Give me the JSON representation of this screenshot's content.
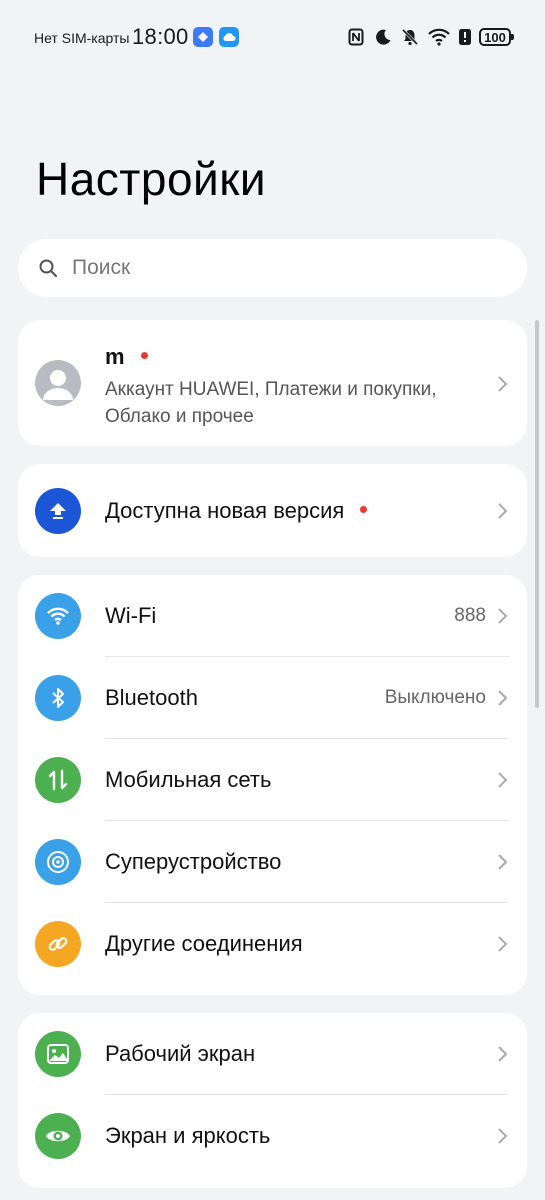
{
  "status_bar": {
    "carrier": "Нет SIM-карты",
    "time": "18:00",
    "battery": "100",
    "icons": [
      "nfc-icon",
      "moon-icon",
      "bell-off-icon",
      "wifi-icon",
      "alert-icon",
      "battery-icon"
    ]
  },
  "page_title": "Настройки",
  "search": {
    "placeholder": "Поиск"
  },
  "account": {
    "name": "m",
    "subtitle": "Аккаунт HUAWEI, Платежи и покупки, Облако и прочее"
  },
  "update": {
    "label": "Доступна новая версия"
  },
  "connectivity": [
    {
      "label": "Wi-Fi",
      "value": "888",
      "icon": "wifi-icon",
      "color": "#3aa0e8"
    },
    {
      "label": "Bluetooth",
      "value": "Выключено",
      "icon": "bluetooth-icon",
      "color": "#3aa0e8"
    },
    {
      "label": "Мобильная сеть",
      "value": "",
      "icon": "mobile-data-icon",
      "color": "#4cb050"
    },
    {
      "label": "Суперустройство",
      "value": "",
      "icon": "super-device-icon",
      "color": "#3aa0e8"
    },
    {
      "label": "Другие соединения",
      "value": "",
      "icon": "link-icon",
      "color": "#f5a623"
    }
  ],
  "display": [
    {
      "label": "Рабочий экран",
      "icon": "wallpaper-icon",
      "color": "#4cb050"
    },
    {
      "label": "Экран и яркость",
      "icon": "eye-icon",
      "color": "#4cb050"
    }
  ],
  "colors": {
    "background": "#f1f3f5",
    "card": "#ffffff",
    "accent_blue": "#1a56d6",
    "badge_red": "#e53935"
  }
}
